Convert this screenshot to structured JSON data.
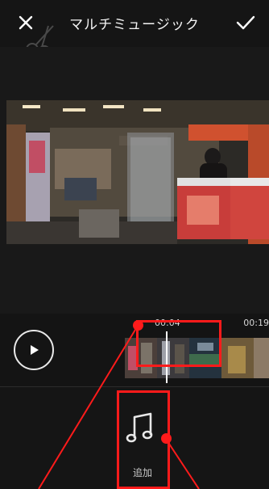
{
  "header": {
    "title": "マルチミュージック",
    "close_icon": "close-icon",
    "confirm_icon": "check-icon"
  },
  "player": {
    "current_time": "00:04",
    "total_time": "00:19",
    "play_icon": "play-icon"
  },
  "bottom": {
    "add_label": "追加",
    "add_icon": "music-note-icon"
  },
  "colors": {
    "background": "#141414",
    "annotation": "#ff1b1b",
    "text": "#ffffff"
  }
}
